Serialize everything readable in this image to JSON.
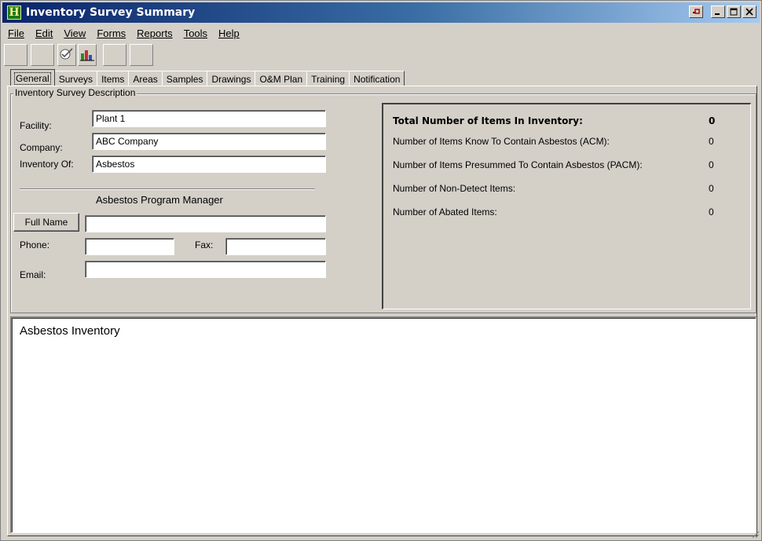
{
  "window": {
    "title": "Inventory Survey Summary",
    "app_icon_letter": "H",
    "controls": {
      "restore": "▫",
      "minimize": "_",
      "maximize": "□",
      "close": "×"
    }
  },
  "menu": [
    {
      "label": "File"
    },
    {
      "label": "Edit"
    },
    {
      "label": "View"
    },
    {
      "label": "Forms"
    },
    {
      "label": "Reports"
    },
    {
      "label": "Tools"
    },
    {
      "label": "Help"
    }
  ],
  "tabs": [
    {
      "label": "General",
      "active": true
    },
    {
      "label": "Surveys"
    },
    {
      "label": "Items"
    },
    {
      "label": "Areas"
    },
    {
      "label": "Samples"
    },
    {
      "label": "Drawings"
    },
    {
      "label": "O&M Plan"
    },
    {
      "label": "Training"
    },
    {
      "label": "Notification"
    }
  ],
  "description": {
    "legend": "Inventory Survey Description",
    "facility_label": "Facility:",
    "facility_value": "Plant 1",
    "company_label": "Company:",
    "company_value": "ABC Company",
    "inventory_of_label": "Inventory Of:",
    "inventory_of_value": "Asbestos",
    "manager_heading": "Asbestos Program Manager",
    "full_name_button": "Full Name",
    "full_name_value": "",
    "phone_label": "Phone:",
    "phone_value": "",
    "fax_label": "Fax:",
    "fax_value": "",
    "email_label": "Email:",
    "email_value": ""
  },
  "stats": [
    {
      "label": "Total Number of Items In Inventory:",
      "value": "0"
    },
    {
      "label": "Number of Items Know To  Contain Asbestos (ACM):",
      "value": "0"
    },
    {
      "label": "Number of Items Presummed To Contain Asbestos (PACM):",
      "value": "0"
    },
    {
      "label": "Number of Non-Detect Items:",
      "value": "0"
    },
    {
      "label": "Number of Abated Items:",
      "value": "0"
    }
  ],
  "bottom_panel": {
    "title": "Asbestos Inventory"
  },
  "colors": {
    "title_gradient_start": "#0a246a",
    "title_gradient_end": "#a6caf0",
    "face": "#d4d0c8"
  },
  "toolbar_icons": [
    "blank",
    "blank",
    "check-icon",
    "chart-icon",
    "blank",
    "blank"
  ]
}
